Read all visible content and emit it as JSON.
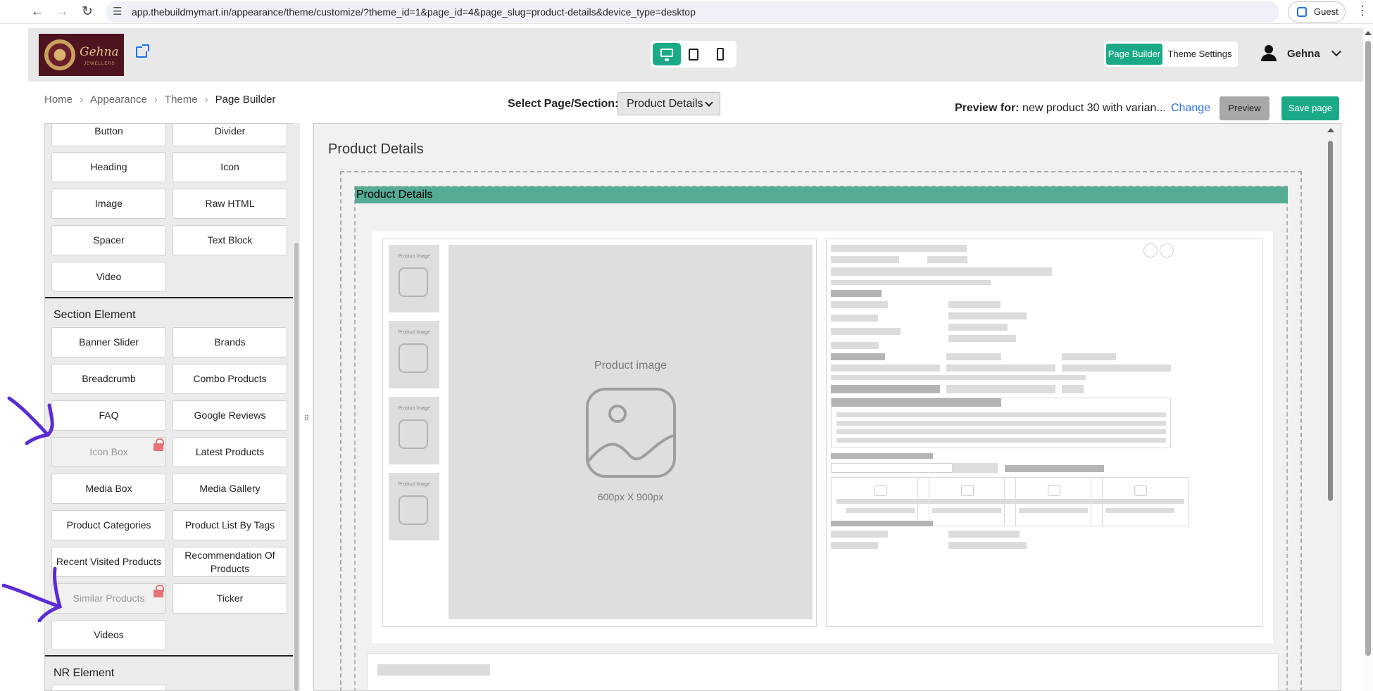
{
  "browser": {
    "url": "app.thebuildmymart.in/appearance/theme/customize/?theme_id=1&page_id=4&page_slug=product-details&device_type=desktop",
    "profile_label": "Guest"
  },
  "header": {
    "logo_text": "Gehna",
    "logo_subtext": "JEWELLERS",
    "modes": [
      "Page Builder",
      "Theme Settings"
    ],
    "active_mode": "Page Builder",
    "user_name": "Gehna",
    "devices": [
      "desktop",
      "tablet",
      "mobile"
    ],
    "active_device": "desktop"
  },
  "breadcrumb": [
    "Home",
    "Appearance",
    "Theme",
    "Page Builder"
  ],
  "toolbar": {
    "select_label": "Select Page/Section:",
    "selected_page": "Product Details",
    "preview_for_label": "Preview for:",
    "preview_for_value": "new product 30 with varian...",
    "change_label": "Change",
    "preview_button": "Preview",
    "save_button": "Save page"
  },
  "panel": {
    "basic_elements": [
      "Button",
      "Divider",
      "Heading",
      "Icon",
      "Image",
      "Raw HTML",
      "Spacer",
      "Text Block",
      "Video"
    ],
    "section_heading": "Section Element",
    "section_elements": [
      {
        "label": "Banner Slider",
        "locked": false
      },
      {
        "label": "Brands",
        "locked": false
      },
      {
        "label": "Breadcrumb",
        "locked": false
      },
      {
        "label": "Combo Products",
        "locked": false
      },
      {
        "label": "FAQ",
        "locked": false
      },
      {
        "label": "Google Reviews",
        "locked": false
      },
      {
        "label": "Icon Box",
        "locked": true
      },
      {
        "label": "Latest Products",
        "locked": false
      },
      {
        "label": "Media Box",
        "locked": false
      },
      {
        "label": "Media Gallery",
        "locked": false
      },
      {
        "label": "Product Categories",
        "locked": false
      },
      {
        "label": "Product List By Tags",
        "locked": false
      },
      {
        "label": "Recent Visited Products",
        "locked": false
      },
      {
        "label": "Recommendation Of Products",
        "locked": false
      },
      {
        "label": "Similar Products",
        "locked": true
      },
      {
        "label": "Ticker",
        "locked": false
      },
      {
        "label": "Videos",
        "locked": false
      }
    ],
    "nr_heading": "NR Element"
  },
  "canvas": {
    "title": "Product Details",
    "section_bar_label": "Product Details",
    "thumb_label": "Product Image",
    "main_image_label": "Product image",
    "main_image_size": "600px X 900px"
  },
  "colors": {
    "accent": "#1aaa88",
    "section_bar": "#55ab94",
    "annotation_arrow": "#5b2bd6",
    "link": "#2a6ee8"
  }
}
